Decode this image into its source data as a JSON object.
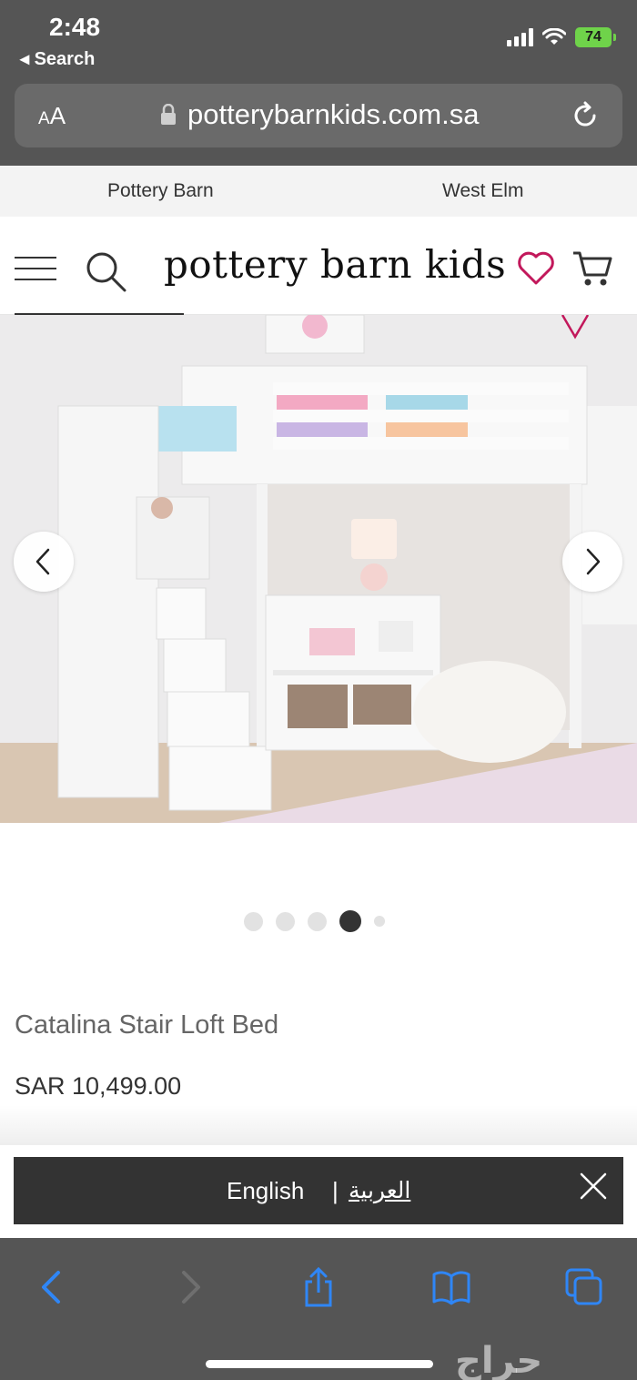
{
  "status_bar": {
    "time": "2:48",
    "back_label": "◂ Search",
    "battery": "74"
  },
  "browser": {
    "text_size_label_small": "A",
    "text_size_label_large": "A",
    "url": "potterybarnkids.com.sa"
  },
  "brand_switcher": {
    "items": [
      "Pottery Barn",
      "West Elm"
    ]
  },
  "header": {
    "logo": "pottery barn kids"
  },
  "carousel": {
    "slide_count": 5,
    "active_index": 3
  },
  "product": {
    "title": "Catalina Stair Loft Bed",
    "price": "SAR 10,499.00"
  },
  "language_banner": {
    "english": "English",
    "separator": "|",
    "arabic": "العربية"
  },
  "watermark": "حراج",
  "colors": {
    "chrome_gray": "#555555",
    "ios_blue": "#2f86f6",
    "heart_red": "#c2185b",
    "banner_dark": "#333333"
  }
}
